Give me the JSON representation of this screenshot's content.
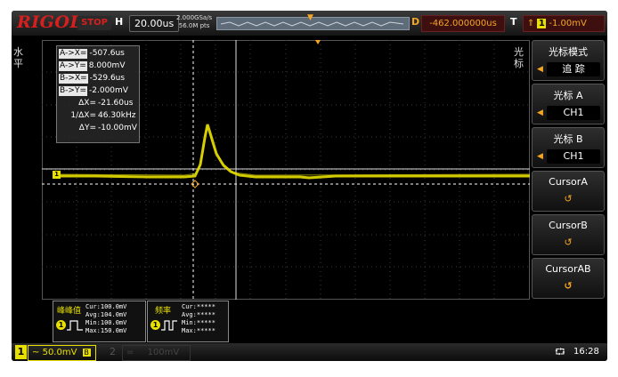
{
  "brand": "RIGOL",
  "status": "STOP",
  "horizontal": {
    "label": "H",
    "timebase": "20.00us",
    "sample_rate": "2.000GSa/s",
    "mem_depth": "56.0M pts"
  },
  "delay": {
    "label": "D",
    "value": "-462.000000us"
  },
  "trigger": {
    "label": "T",
    "edge_icon": "rising-edge-icon",
    "source": "1",
    "level": "-1.00mV"
  },
  "left_side_label": "水\n平",
  "right_side_label": "光\n标",
  "readout": [
    {
      "label": "A->X=",
      "value": "-507.6us"
    },
    {
      "label": "A->Y=",
      "value": "8.000mV"
    },
    {
      "label": "B->X=",
      "value": "-529.6us"
    },
    {
      "label": "B->Y=",
      "value": "-2.000mV"
    },
    {
      "label": "ΔX=",
      "value": "-21.60us"
    },
    {
      "label": "1/ΔX=",
      "value": "46.30kHz"
    },
    {
      "label": "ΔY=",
      "value": "-10.00mV"
    }
  ],
  "menu": {
    "mode_title": "光标模式",
    "mode_value": "追 踪",
    "cursor_a_title": "光标 A",
    "cursor_a_value": "CH1",
    "cursor_b_title": "光标 B",
    "cursor_b_value": "CH1",
    "cursorA": "CursorA",
    "cursorB": "CursorB",
    "cursorAB": "CursorAB"
  },
  "measurements": [
    {
      "name": "峰峰值",
      "channel": "1",
      "lines": [
        "Cur:100.0mV",
        "Avg:104.0mV",
        "Min:100.0mV",
        "Max:150.0mV"
      ]
    },
    {
      "name": "频率",
      "channel": "1",
      "lines": [
        "Cur:*****",
        "Avg:*****",
        "Min:*****",
        "Max:*****"
      ]
    }
  ],
  "channels": [
    {
      "number": "1",
      "scale": "50.0mV",
      "coupling": "B"
    },
    {
      "number": "2",
      "scale": "100mV"
    }
  ],
  "clock": "16:28",
  "colors": {
    "ch1": "#e8e000",
    "accent": "#f5a623",
    "logo": "#d81f1f"
  }
}
